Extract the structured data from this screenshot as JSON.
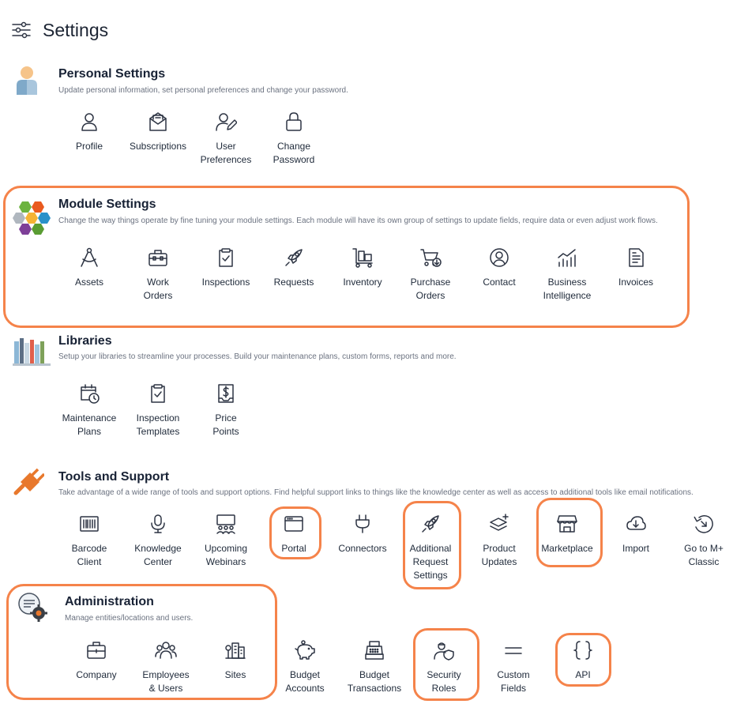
{
  "page": {
    "title": "Settings",
    "icon": "sliders-icon"
  },
  "sections": {
    "personal": {
      "title": "Personal Settings",
      "description": "Update personal information, set personal preferences and change your password.",
      "items": [
        {
          "label": "Profile",
          "icon": "user-icon"
        },
        {
          "label": "Subscriptions",
          "icon": "envelope-icon"
        },
        {
          "label": "User\nPreferences",
          "icon": "user-edit-icon"
        },
        {
          "label": "Change\nPassword",
          "icon": "lock-icon"
        }
      ]
    },
    "module": {
      "title": "Module Settings",
      "description": "Change the way things operate by fine tuning your module settings. Each module will have its own group of settings to update fields, require data or even adjust work flows.",
      "items": [
        {
          "label": "Assets",
          "icon": "compass-icon"
        },
        {
          "label": "Work\nOrders",
          "icon": "toolbox-icon"
        },
        {
          "label": "Inspections",
          "icon": "clipboard-check-icon"
        },
        {
          "label": "Requests",
          "icon": "rocket-icon"
        },
        {
          "label": "Inventory",
          "icon": "dolly-icon"
        },
        {
          "label": "Purchase\nOrders",
          "icon": "cart-icon"
        },
        {
          "label": "Contact",
          "icon": "user-circle-icon"
        },
        {
          "label": "Business\nIntelligence",
          "icon": "chart-icon"
        },
        {
          "label": "Invoices",
          "icon": "invoice-icon"
        }
      ]
    },
    "libraries": {
      "title": "Libraries",
      "description": "Setup your libraries to streamline your processes. Build your maintenance plans, custom forms, reports and more.",
      "items": [
        {
          "label": "Maintenance\nPlans",
          "icon": "calendar-clock-icon"
        },
        {
          "label": "Inspection\nTemplates",
          "icon": "clipboard-check-icon"
        },
        {
          "label": "Price\nPoints",
          "icon": "dollar-doc-icon"
        }
      ]
    },
    "tools": {
      "title": "Tools and Support",
      "description": "Take advantage of a wide range of tools and support options. Find helpful support links to things like the knowledge center as well as access to additional tools like email notifications.",
      "items": [
        {
          "label": "Barcode\nClient",
          "icon": "barcode-icon"
        },
        {
          "label": "Knowledge\nCenter",
          "icon": "microphone-icon"
        },
        {
          "label": "Upcoming\nWebinars",
          "icon": "webinar-icon"
        },
        {
          "label": "Portal",
          "icon": "window-icon"
        },
        {
          "label": "Connectors",
          "icon": "plug-icon"
        },
        {
          "label": "Additional\nRequest\nSettings",
          "icon": "rocket-icon"
        },
        {
          "label": "Product\nUpdates",
          "icon": "layers-plus-icon"
        },
        {
          "label": "Marketplace",
          "icon": "store-icon"
        },
        {
          "label": "Import",
          "icon": "cloud-download-icon"
        },
        {
          "label": "Go to M+\nClassic",
          "icon": "arrow-circle-icon"
        }
      ]
    },
    "admin": {
      "title": "Administration",
      "description": "Manage entities/locations and users.",
      "items": [
        {
          "label": "Company",
          "icon": "briefcase-icon"
        },
        {
          "label": "Employees\n& Users",
          "icon": "users-icon"
        },
        {
          "label": "Sites",
          "icon": "buildings-icon"
        },
        {
          "label": "Budget\nAccounts",
          "icon": "piggy-bank-icon"
        },
        {
          "label": "Budget\nTransactions",
          "icon": "cash-register-icon"
        },
        {
          "label": "Security\nRoles",
          "icon": "user-shield-icon"
        },
        {
          "label": "Custom\nFields",
          "icon": "equals-icon"
        },
        {
          "label": "API",
          "icon": "braces-icon"
        }
      ]
    }
  },
  "colors": {
    "highlight": "#f5834a",
    "text": "#1f2a3a",
    "muted": "#6b7280",
    "icon_stroke": "#2d3443"
  }
}
